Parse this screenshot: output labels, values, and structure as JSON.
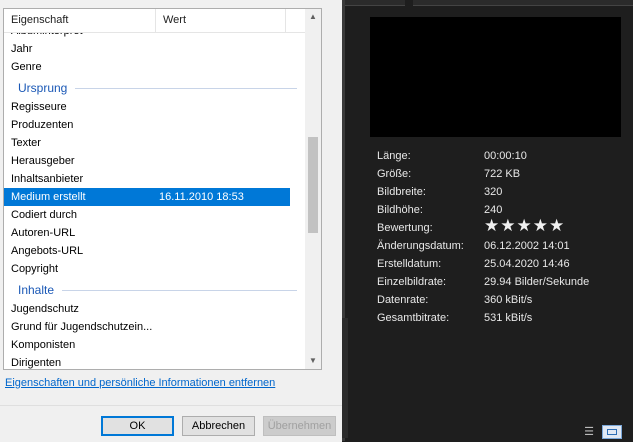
{
  "dialog": {
    "header": {
      "name": "Eigenschaft",
      "value": "Wert"
    },
    "rows": [
      {
        "type": "item",
        "name": "Albuminterpret",
        "value": ""
      },
      {
        "type": "item",
        "name": "Jahr",
        "value": ""
      },
      {
        "type": "item",
        "name": "Genre",
        "value": ""
      },
      {
        "type": "group",
        "name": "Ursprung"
      },
      {
        "type": "item",
        "name": "Regisseure",
        "value": ""
      },
      {
        "type": "item",
        "name": "Produzenten",
        "value": ""
      },
      {
        "type": "item",
        "name": "Texter",
        "value": ""
      },
      {
        "type": "item",
        "name": "Herausgeber",
        "value": ""
      },
      {
        "type": "item",
        "name": "Inhaltsanbieter",
        "value": ""
      },
      {
        "type": "item",
        "name": "Medium erstellt",
        "value": "16.11.2010 18:53",
        "selected": true
      },
      {
        "type": "item",
        "name": "Codiert durch",
        "value": ""
      },
      {
        "type": "item",
        "name": "Autoren-URL",
        "value": ""
      },
      {
        "type": "item",
        "name": "Angebots-URL",
        "value": ""
      },
      {
        "type": "item",
        "name": "Copyright",
        "value": ""
      },
      {
        "type": "group",
        "name": "Inhalte"
      },
      {
        "type": "item",
        "name": "Jugendschutz",
        "value": ""
      },
      {
        "type": "item",
        "name": "Grund für Jugendschutzein...",
        "value": ""
      },
      {
        "type": "item",
        "name": "Komponisten",
        "value": ""
      },
      {
        "type": "item",
        "name": "Dirigenten",
        "value": ""
      }
    ],
    "remove_link": "Eigenschaften und persönliche Informationen entfernen",
    "buttons": {
      "ok": "OK",
      "cancel": "Abbrechen",
      "apply": "Übernehmen"
    }
  },
  "details": {
    "length_label": "Länge:",
    "length": "00:00:10",
    "size_label": "Größe:",
    "size": "722 KB",
    "width_label": "Bildbreite:",
    "width": "320",
    "height_label": "Bildhöhe:",
    "height": "240",
    "rating_label": "Bewertung:",
    "rating_stars": "★★★★★",
    "rating_value": 5,
    "modified_label": "Änderungsdatum:",
    "modified": "06.12.2002 14:01",
    "created_label": "Erstelldatum:",
    "created": "25.04.2020 14:46",
    "framerate_label": "Einzelbildrate:",
    "framerate": "29.94 Bilder/Sekunde",
    "datarate_label": "Datenrate:",
    "datarate": "360 kBit/s",
    "totalbitrate_label": "Gesamtbitrate:",
    "totalbitrate": "531 kBit/s"
  },
  "colors": {
    "selection": "#0078d7",
    "group_text": "#1a58b6",
    "link": "#0066cc",
    "dark_bg": "#1e1e1e"
  },
  "icons": [
    "scroll-up-icon",
    "scroll-down-icon",
    "details-view-icon",
    "tiles-view-icon"
  ]
}
